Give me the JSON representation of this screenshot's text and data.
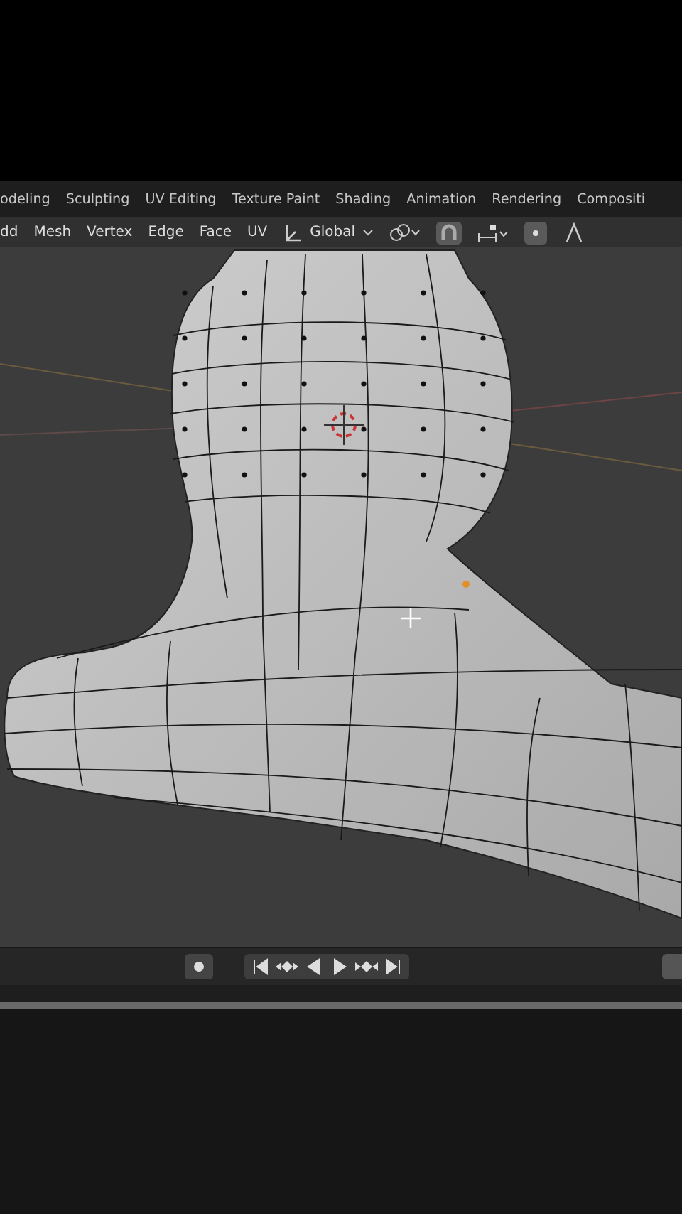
{
  "workspace_tabs": [
    {
      "label": "odeling"
    },
    {
      "label": "Sculpting"
    },
    {
      "label": "UV Editing"
    },
    {
      "label": "Texture Paint"
    },
    {
      "label": "Shading"
    },
    {
      "label": "Animation"
    },
    {
      "label": "Rendering"
    },
    {
      "label": "Compositi"
    }
  ],
  "header_menu": [
    "dd",
    "Mesh",
    "Vertex",
    "Edge",
    "Face",
    "UV"
  ],
  "transform_orientation": {
    "value": "Global"
  },
  "header_toggles": [
    {
      "kind": "snap",
      "on": true
    },
    {
      "kind": "vertex-mode",
      "on": true
    },
    {
      "kind": "edge-mode",
      "on": false
    }
  ],
  "playback": {
    "record_on": false
  }
}
